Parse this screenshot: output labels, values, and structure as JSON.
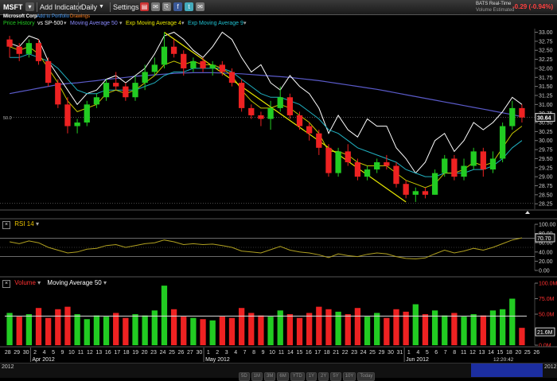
{
  "toolbar": {
    "symbol": "MSFT",
    "add_indicator": "Add Indicator",
    "interval": "Daily",
    "settings": "Settings",
    "feed": "BATS Real-Time",
    "feed_sub": "Volume Estimated",
    "change": "-0.29 (-0.94%)"
  },
  "infobar": {
    "company": "Microsoft Corp",
    "add_portfolio": "Add to Portfolio",
    "drawings": "Drawings"
  },
  "legend": {
    "price": "Price History",
    "compare": "vs SP-500",
    "ma50": "Moving Average 50",
    "ema4": "Exp Moving Average 4",
    "ema9": "Exp Moving Average 9"
  },
  "colors": {
    "up": "#22cc22",
    "down": "#ee2222",
    "ma50": "#5a5ac8",
    "ema4": "#c8c800",
    "ema9": "#20b0c0",
    "compare": "#ffffff",
    "rsi": "#b0a020",
    "trend": "#e8e800"
  },
  "chart_data": [
    {
      "type": "candlestick",
      "title": "MSFT",
      "ylim": [
        28.1,
        33.1
      ],
      "yticks": [
        "33.00",
        "32.75",
        "32.50",
        "32.25",
        "32.00",
        "31.75",
        "31.50",
        "31.25",
        "31.00",
        "30.75",
        "30.50",
        "30.25",
        "30.00",
        "29.75",
        "29.50",
        "29.25",
        "29.00",
        "28.75",
        "28.50",
        "28.25"
      ],
      "last_price": "30.64",
      "ref_level_label": "50.0",
      "ohlc": [
        [
          32.8,
          32.9,
          32.3,
          32.6
        ],
        [
          32.6,
          32.7,
          32.2,
          32.4
        ],
        [
          32.4,
          32.8,
          32.3,
          32.7
        ],
        [
          32.7,
          32.8,
          32.1,
          32.2
        ],
        [
          32.2,
          32.3,
          31.5,
          31.6
        ],
        [
          31.6,
          31.7,
          30.9,
          31.0
        ],
        [
          31.0,
          31.2,
          30.2,
          30.4
        ],
        [
          30.4,
          30.6,
          30.2,
          30.5
        ],
        [
          30.5,
          31.1,
          30.4,
          31.0
        ],
        [
          31.0,
          31.3,
          30.9,
          31.2
        ],
        [
          31.2,
          31.7,
          31.1,
          31.6
        ],
        [
          31.6,
          31.9,
          31.4,
          31.5
        ],
        [
          31.5,
          31.6,
          31.1,
          31.2
        ],
        [
          31.2,
          31.8,
          31.1,
          31.6
        ],
        [
          31.6,
          32.1,
          31.4,
          31.9
        ],
        [
          31.9,
          32.3,
          31.8,
          32.1
        ],
        [
          32.1,
          33.0,
          32.0,
          32.6
        ],
        [
          32.6,
          32.8,
          32.3,
          32.4
        ],
        [
          32.4,
          32.5,
          31.8,
          32.0
        ],
        [
          32.0,
          32.3,
          31.9,
          32.2
        ],
        [
          32.2,
          32.3,
          31.9,
          32.0
        ],
        [
          32.0,
          32.2,
          31.8,
          32.1
        ],
        [
          32.1,
          32.2,
          31.8,
          31.9
        ],
        [
          31.9,
          32.0,
          31.5,
          31.6
        ],
        [
          31.6,
          31.7,
          30.8,
          30.9
        ],
        [
          30.9,
          31.0,
          30.6,
          30.7
        ],
        [
          30.7,
          30.8,
          30.4,
          30.6
        ],
        [
          30.6,
          31.1,
          30.3,
          30.9
        ],
        [
          30.9,
          31.5,
          30.8,
          31.2
        ],
        [
          31.2,
          31.3,
          30.6,
          30.7
        ],
        [
          30.7,
          30.8,
          30.3,
          30.4
        ],
        [
          30.4,
          30.5,
          30.0,
          30.2
        ],
        [
          30.2,
          30.3,
          29.6,
          29.8
        ],
        [
          29.8,
          29.9,
          29.0,
          29.1
        ],
        [
          29.1,
          29.8,
          29.0,
          29.7
        ],
        [
          29.7,
          29.9,
          29.3,
          29.4
        ],
        [
          29.4,
          29.5,
          28.9,
          29.0
        ],
        [
          29.0,
          29.3,
          28.9,
          29.2
        ],
        [
          29.2,
          29.5,
          29.1,
          29.4
        ],
        [
          29.4,
          29.6,
          29.2,
          29.3
        ],
        [
          29.3,
          29.4,
          28.7,
          28.8
        ],
        [
          28.8,
          28.9,
          28.4,
          28.5
        ],
        [
          28.5,
          28.7,
          28.3,
          28.6
        ],
        [
          28.6,
          28.7,
          28.4,
          28.5
        ],
        [
          28.5,
          29.2,
          28.5,
          29.1
        ],
        [
          29.1,
          29.6,
          29.0,
          29.5
        ],
        [
          29.5,
          29.6,
          28.9,
          29.0
        ],
        [
          29.0,
          29.5,
          28.9,
          29.3
        ],
        [
          29.3,
          29.8,
          29.2,
          29.7
        ],
        [
          29.7,
          29.8,
          29.0,
          29.2
        ],
        [
          29.2,
          29.7,
          29.1,
          29.5
        ],
        [
          29.5,
          30.5,
          29.4,
          30.4
        ],
        [
          30.4,
          31.1,
          30.3,
          30.9
        ],
        [
          30.9,
          31.0,
          30.5,
          30.64
        ]
      ],
      "ma50": [
        31.3,
        31.35,
        31.4,
        31.45,
        31.5,
        31.55,
        31.58,
        31.6,
        31.63,
        31.66,
        31.7,
        31.72,
        31.75,
        31.78,
        31.8,
        31.82,
        31.84,
        31.86,
        31.87,
        31.88,
        31.88,
        31.88,
        31.87,
        31.86,
        31.85,
        31.83,
        31.81,
        31.79,
        31.77,
        31.75,
        31.72,
        31.69,
        31.66,
        31.62,
        31.58,
        31.54,
        31.5,
        31.46,
        31.42,
        31.37,
        31.32,
        31.27,
        31.22,
        31.17,
        31.12,
        31.07,
        31.02,
        30.97,
        30.92,
        30.87,
        30.82,
        30.77,
        30.72,
        30.66
      ],
      "ema4": [
        32.6,
        32.5,
        32.6,
        32.4,
        32.0,
        31.6,
        31.1,
        30.8,
        30.9,
        31.0,
        31.3,
        31.4,
        31.3,
        31.4,
        31.6,
        31.8,
        32.1,
        32.2,
        32.1,
        32.2,
        32.1,
        32.1,
        32.0,
        31.8,
        31.4,
        31.1,
        30.9,
        30.9,
        31.0,
        30.9,
        30.7,
        30.5,
        30.2,
        29.7,
        29.7,
        29.6,
        29.4,
        29.3,
        29.3,
        29.3,
        29.1,
        28.9,
        28.8,
        28.7,
        28.8,
        29.1,
        29.1,
        29.2,
        29.4,
        29.3,
        29.4,
        29.8,
        30.2,
        30.4
      ],
      "ema9": [
        32.3,
        32.3,
        32.4,
        32.3,
        32.2,
        32.0,
        31.7,
        31.4,
        31.3,
        31.3,
        31.4,
        31.4,
        31.4,
        31.4,
        31.5,
        31.6,
        31.8,
        31.9,
        31.9,
        32.0,
        32.0,
        32.0,
        32.0,
        31.9,
        31.7,
        31.5,
        31.3,
        31.2,
        31.2,
        31.1,
        31.0,
        30.8,
        30.6,
        30.3,
        30.2,
        30.0,
        29.8,
        29.7,
        29.6,
        29.5,
        29.4,
        29.2,
        29.1,
        29.0,
        29.0,
        29.1,
        29.1,
        29.1,
        29.2,
        29.2,
        29.3,
        29.5,
        29.8,
        30.0
      ],
      "compare_sp500": [
        32.7,
        32.6,
        32.9,
        32.8,
        32.2,
        31.8,
        31.4,
        31.0,
        31.3,
        31.4,
        31.7,
        31.8,
        31.6,
        31.8,
        32.0,
        32.4,
        32.9,
        33.0,
        32.8,
        32.5,
        32.3,
        32.6,
        33.0,
        32.8,
        32.3,
        31.9,
        32.1,
        31.6,
        31.4,
        31.8,
        31.5,
        31.3,
        30.9,
        30.2,
        30.7,
        30.3,
        30.1,
        30.6,
        30.4,
        30.4,
        29.8,
        29.5,
        29.1,
        29.4,
        30.0,
        30.2,
        29.7,
        30.0,
        30.5,
        30.3,
        30.5,
        30.8,
        31.2,
        31.0
      ],
      "trendlines": [
        {
          "from": [
            16,
            33.0
          ],
          "to": [
            41,
            28.3
          ]
        }
      ]
    },
    {
      "type": "line",
      "title": "RSI 14",
      "ylim": [
        0,
        100
      ],
      "yticks": [
        "100.00",
        "80.00",
        "60.00",
        "40.00",
        "20.00",
        "0.00"
      ],
      "last_value": "70.70",
      "levels": [
        70,
        30
      ],
      "values": [
        62,
        58,
        64,
        60,
        50,
        44,
        38,
        40,
        46,
        48,
        54,
        56,
        50,
        54,
        58,
        60,
        66,
        62,
        56,
        58,
        56,
        57,
        54,
        50,
        42,
        40,
        38,
        45,
        52,
        44,
        40,
        38,
        34,
        28,
        36,
        32,
        30,
        35,
        38,
        36,
        30,
        26,
        25,
        27,
        36,
        44,
        38,
        42,
        48,
        44,
        50,
        58,
        66,
        70.7
      ]
    },
    {
      "type": "bar",
      "title": "Volume",
      "overlay": "Moving Average 50",
      "ylim": [
        0,
        100
      ],
      "yticks": [
        "100.0M",
        "75.0M",
        "50.0M",
        "25.0M",
        "0.0M"
      ],
      "last_value": "21.6M",
      "ma50_level": 47,
      "values": [
        52,
        46,
        50,
        60,
        44,
        58,
        62,
        50,
        42,
        48,
        46,
        52,
        44,
        50,
        48,
        56,
        96,
        58,
        46,
        44,
        42,
        40,
        46,
        44,
        60,
        52,
        48,
        46,
        56,
        50,
        44,
        52,
        62,
        58,
        54,
        50,
        60,
        46,
        52,
        44,
        58,
        54,
        66,
        50,
        56,
        48,
        52,
        46,
        50,
        48,
        56,
        58,
        75,
        28
      ],
      "up": [
        true,
        false,
        true,
        false,
        false,
        false,
        false,
        true,
        true,
        true,
        true,
        false,
        false,
        true,
        true,
        true,
        true,
        false,
        false,
        true,
        false,
        true,
        false,
        false,
        false,
        false,
        false,
        true,
        true,
        false,
        false,
        false,
        false,
        false,
        true,
        false,
        false,
        true,
        true,
        false,
        false,
        false,
        true,
        false,
        true,
        true,
        false,
        true,
        true,
        false,
        true,
        true,
        true,
        false
      ]
    }
  ],
  "xaxis": {
    "day_labels": [
      "28",
      "29",
      "30",
      "2",
      "4",
      "5",
      "9",
      "10",
      "11",
      "12",
      "13",
      "16",
      "17",
      "18",
      "19",
      "20",
      "23",
      "24",
      "25",
      "26",
      "27",
      "30",
      "1",
      "2",
      "3",
      "4",
      "7",
      "8",
      "9",
      "10",
      "11",
      "14",
      "15",
      "16",
      "17",
      "18",
      "21",
      "22",
      "23",
      "24",
      "25",
      "29",
      "30",
      "31",
      "1",
      "4",
      "5",
      "6",
      "7",
      "8",
      "11",
      "12",
      "13",
      "14",
      "15",
      "18",
      "20",
      "25",
      "26"
    ],
    "month_labels": [
      {
        "text": "Apr 2012",
        "at": 3
      },
      {
        "text": "May 2012",
        "at": 22
      },
      {
        "text": "Jun 2012",
        "at": 44
      }
    ],
    "year_left": "2012",
    "clock": "12:20:42",
    "year_right": "2012"
  },
  "scroll_buttons": [
    "5D",
    "1M",
    "3M",
    "6M",
    "YTD",
    "1Y",
    "2Y",
    "5Y",
    "10Y",
    "Today"
  ]
}
